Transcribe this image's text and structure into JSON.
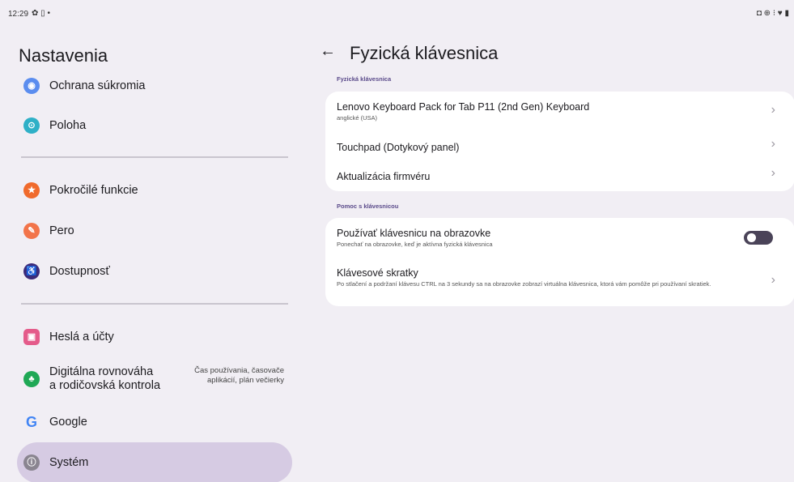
{
  "status_bar": {
    "time": "12:29",
    "left_icons": "✿ ▯ •",
    "right_icons": "◘ ⊕ ⁝ ♥ ▮"
  },
  "left_pane": {
    "title": "Nastavenia",
    "items": [
      {
        "label": "Ochrana súkromia",
        "icon": "privacy-icon",
        "color": "#5b8def"
      },
      {
        "label": "Poloha",
        "icon": "location-icon",
        "color": "#2fb0c7"
      },
      {
        "label": "Pokročilé funkcie",
        "icon": "star-icon",
        "color": "#f06a2c"
      },
      {
        "label": "Pero",
        "icon": "pen-icon",
        "color": "#f2744a"
      },
      {
        "label": "Dostupnosť",
        "icon": "accessibility-icon",
        "color": "#3d2a78"
      },
      {
        "label": "Heslá a účty",
        "icon": "accounts-icon",
        "color": "#e45b8a"
      },
      {
        "label_line1": "Digitálna rovnováha",
        "label_line2": "a rodičovská kontrola",
        "sub_line1": "Čas používania, časovače",
        "sub_line2": "aplikácií, plán večierky",
        "icon": "wellbeing-icon",
        "color": "#1fa855"
      },
      {
        "label": "Google",
        "icon": "google-icon",
        "color": "#4285f4"
      },
      {
        "label": "Systém",
        "icon": "system-icon",
        "color": "#8a8590"
      }
    ]
  },
  "right_pane": {
    "title": "Fyzická klávesnica",
    "section1_label": "Fyzická klávesnica",
    "keyboard_title": "Lenovo Keyboard Pack for Tab P11 (2nd Gen) Keyboard",
    "keyboard_sub": "anglické (USA)",
    "touchpad_title": "Touchpad (Dotykový panel)",
    "firmware_title": "Aktualizácia firmvéru",
    "section2_label": "Pomoc s klávesnicou",
    "onscreen_title": "Používať klávesnicu na obrazovke",
    "onscreen_sub": "Ponechať na obrazovke, keď je aktívna fyzická klávesnica",
    "onscreen_enabled": false,
    "shortcuts_title": "Klávesové skratky",
    "shortcuts_sub": "Po stlačení a podržaní klávesu CTRL na 3 sekundy sa na obrazovke zobrazí virtuálna klávesnica, ktorá vám pomôže pri používaní skratiek."
  }
}
